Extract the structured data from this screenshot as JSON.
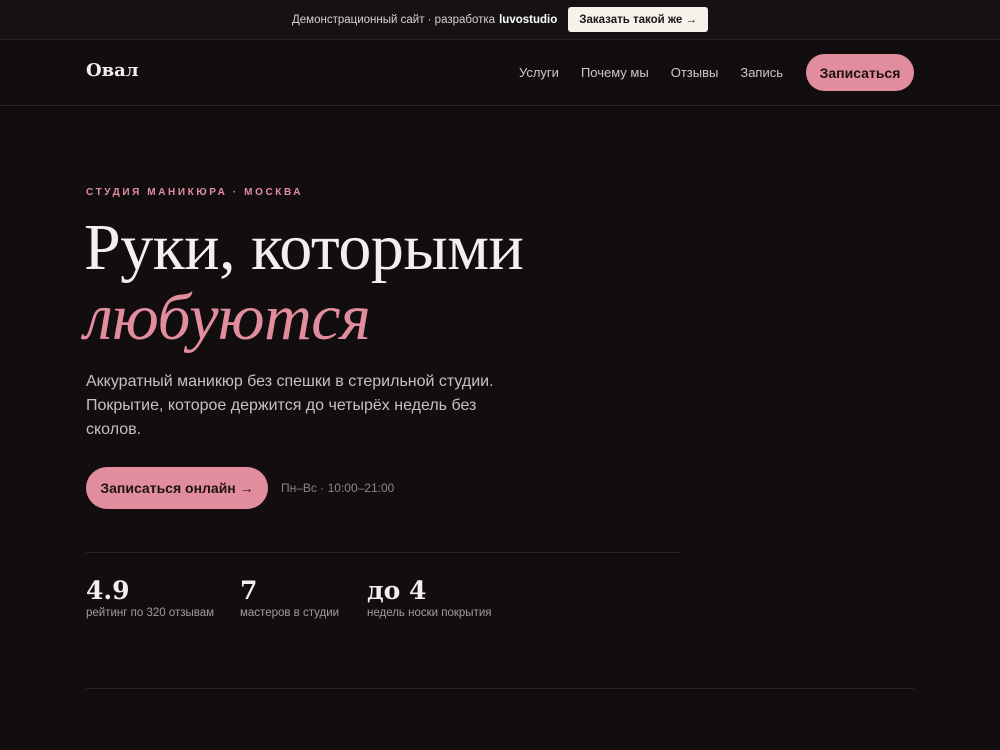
{
  "topbar": {
    "text": "Демонстрационный сайт · разработка",
    "brand": "luvostudio",
    "cta_label": "Заказать такой же →"
  },
  "nav": {
    "logo": "Овал",
    "links": [
      "Услуги",
      "Почему мы",
      "Отзывы",
      "Запись"
    ],
    "cta_label": "Записаться"
  },
  "hero": {
    "eyebrow": "СТУДИЯ МАНИКЮРА · МОСКВА",
    "title": "Руки, которыми",
    "title_accent": "любуются",
    "lead": "Аккуратный маникюр без спешки в стерильной студии. Покрытие, которое держится до четырёх недель без сколов.",
    "cta_label": "Записаться онлайн →",
    "hours": "Пн–Вс · 10:00–21:00"
  },
  "stats": [
    {
      "value": "4.9",
      "label": "рейтинг по 320 отзывам"
    },
    {
      "value": "7",
      "label": "мастеров в студии"
    },
    {
      "value": "до 4",
      "label": "недель носки покрытия"
    }
  ],
  "colors": {
    "background": "#120e0f",
    "accent": "#e28d9d",
    "text": "#f4eeee"
  }
}
